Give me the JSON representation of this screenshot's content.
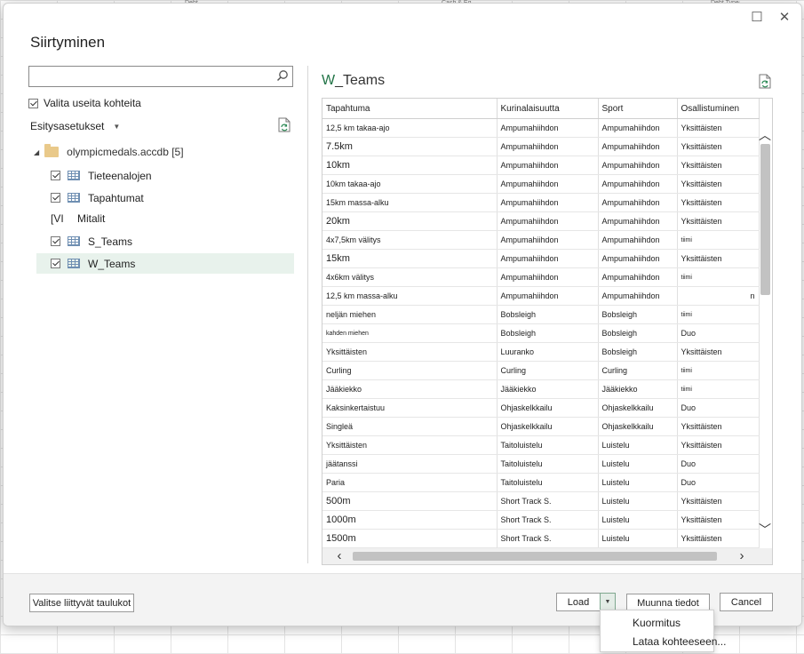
{
  "background": {
    "column_headers": [
      "Debt...",
      "Cash & Eq...",
      "Debt Type"
    ]
  },
  "dialog": {
    "title": "Siirtyminen",
    "search": {
      "value": "",
      "placeholder": ""
    },
    "select_multiple_label": "Valita useita kohteita",
    "display_options_label": "Esitysasetukset",
    "tree": {
      "root_label": "olympicmedals.accdb [5]",
      "items": [
        {
          "label": "Tieteenalojen",
          "checked": true
        },
        {
          "label": "Tapahtumat",
          "checked": true
        },
        {
          "label": "Mitalit",
          "checked": false,
          "marker": "[VI"
        },
        {
          "label": "S_Teams",
          "checked": true
        },
        {
          "label": "W_Teams",
          "checked": true,
          "selected": true
        }
      ]
    },
    "preview": {
      "title_prefix": "W",
      "title_rest": "_Teams",
      "columns": [
        "Tapahtuma",
        "Kurinalaisuutta",
        "Sport",
        "Osallistuminen"
      ],
      "rows": [
        [
          "12,5 km takaa-ajo",
          "Ampumahiihdon",
          "Ampumahiihdon",
          "Yksittäisten"
        ],
        [
          "7.5km",
          "Ampumahiihdon",
          "Ampumahiihdon",
          "Yksittäisten"
        ],
        [
          "10km",
          "Ampumahiihdon",
          "Ampumahiihdon",
          "Yksittäisten"
        ],
        [
          "10km takaa-ajo",
          "Ampumahiihdon",
          "Ampumahiihdon",
          "Yksittäisten"
        ],
        [
          "15km massa-alku",
          "Ampumahiihdon",
          "Ampumahiihdon",
          "Yksittäisten"
        ],
        [
          "20km",
          "Ampumahiihdon",
          "Ampumahiihdon",
          "Yksittäisten"
        ],
        [
          "4x7,5km välitys",
          "Ampumahiihdon",
          "Ampumahiihdon",
          "tiimi"
        ],
        [
          "15km",
          "Ampumahiihdon",
          "Ampumahiihdon",
          "Yksittäisten"
        ],
        [
          "4x6km välitys",
          "Ampumahiihdon",
          "Ampumahiihdon",
          "tiimi"
        ],
        [
          "12,5 km massa-alku",
          "Ampumahiihdon",
          "Ampumahiihdon",
          "n"
        ],
        [
          "neljän miehen",
          "Bobsleigh",
          "Bobsleigh",
          "tiimi"
        ],
        [
          "kahden miehen",
          "Bobsleigh",
          "Bobsleigh",
          "Duo"
        ],
        [
          "Yksittäisten",
          "Luuranko",
          "Bobsleigh",
          "Yksittäisten"
        ],
        [
          "Curling",
          "Curling",
          "Curling",
          "tiimi"
        ],
        [
          "Jääkiekko",
          "Jääkiekko",
          "Jääkiekko",
          "tiimi"
        ],
        [
          "Kaksinkertaistuu",
          "Ohjaskelkkailu",
          "Ohjaskelkkailu",
          "Duo"
        ],
        [
          "Singleä",
          "Ohjaskelkkailu",
          "Ohjaskelkkailu",
          "Yksittäisten"
        ],
        [
          "Yksittäisten",
          "Taitoluistelu",
          "Luistelu",
          "Yksittäisten"
        ],
        [
          "jäätanssi",
          "Taitoluistelu",
          "Luistelu",
          "Duo"
        ],
        [
          "Paria",
          "Taitoluistelu",
          "Luistelu",
          "Duo"
        ],
        [
          "500m",
          "Short Track S.",
          "Luistelu",
          "Yksittäisten"
        ],
        [
          "1000m",
          "Short Track S.",
          "Luistelu",
          "Yksittäisten"
        ],
        [
          "1500m",
          "Short Track S.",
          "Luistelu",
          "Yksittäisten"
        ]
      ]
    },
    "buttons": {
      "select_related": "Valitse liittyvät taulukot",
      "load": "Load",
      "transform": "Muunna tiedot",
      "cancel": "Cancel"
    },
    "load_menu": [
      "Kuormitus",
      "Lataa kohteeseen..."
    ]
  },
  "colors": {
    "accent_green": "#217346",
    "selection_bg": "#e8f2ec"
  }
}
